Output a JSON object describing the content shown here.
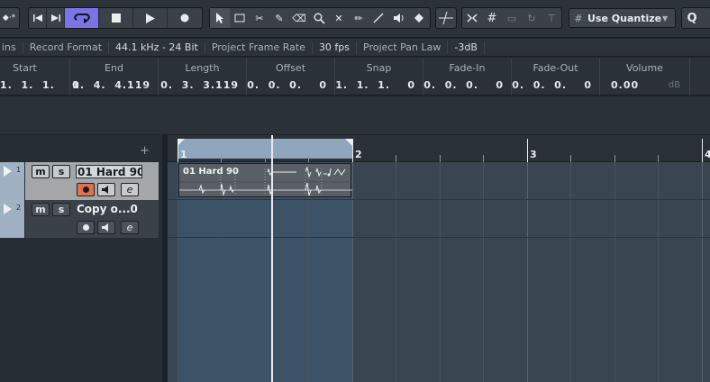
{
  "toolbar": {
    "left_icon": "◆·*",
    "transport": {
      "prev_icon": "go-to-start-icon",
      "next_icon": "go-to-end-icon",
      "cycle_icon": "cycle-icon",
      "stop_icon": "stop-icon",
      "play_icon": "play-icon",
      "record_icon": "record-icon"
    },
    "tools": [
      "pointer-icon",
      "range-icon",
      "split-icon",
      "glue-icon",
      "erase-icon",
      "zoom-icon",
      "mute-icon",
      "draw-icon",
      "line-icon",
      "play-tool-icon",
      "color-icon"
    ],
    "snap_icon": "grid-icon",
    "quantize_label": "Use Quantize",
    "quantize_icon": "#",
    "right_icon": "Q"
  },
  "infoline": {
    "cut_label": "ins",
    "record_format_label": "Record Format",
    "record_format_value": "44.1 kHz - 24 Bit",
    "frame_rate_label": "Project Frame Rate",
    "frame_rate_value": "30 fps",
    "pan_law_label": "Project Pan Law",
    "pan_law_value": "-3dB"
  },
  "eventbar": {
    "start": {
      "label": "Start",
      "value": "1.  1.  1.    0"
    },
    "end": {
      "label": "End",
      "value": "1.  4.  4.119"
    },
    "length": {
      "label": "Length",
      "value": "0.  3.  3.119"
    },
    "offset": {
      "label": "Offset",
      "value": "0.  0.  0.    0"
    },
    "snap": {
      "label": "Snap",
      "value": "1.  1.  1.    0"
    },
    "fade_in": {
      "label": "Fade-In",
      "value": "0.  0.  0.    0"
    },
    "fade_out": {
      "label": "Fade-Out",
      "value": "0.  0.  0.    0"
    },
    "volume": {
      "label": "Volume",
      "value": "0.00",
      "unit": "dB"
    }
  },
  "tracklist": {
    "add_label": "+",
    "tracks": [
      {
        "number": "1",
        "name": "01 Hard 90",
        "mute": "m",
        "solo": "s",
        "edit": "e",
        "record_enabled": true
      },
      {
        "number": "2",
        "name": "Copy o...0",
        "mute": "m",
        "solo": "s",
        "edit": "e",
        "record_enabled": false
      }
    ]
  },
  "ruler": {
    "bars": [
      "1",
      "2",
      "3",
      "4"
    ]
  },
  "events": [
    {
      "name": "01 Hard 90",
      "track": 1
    }
  ]
}
